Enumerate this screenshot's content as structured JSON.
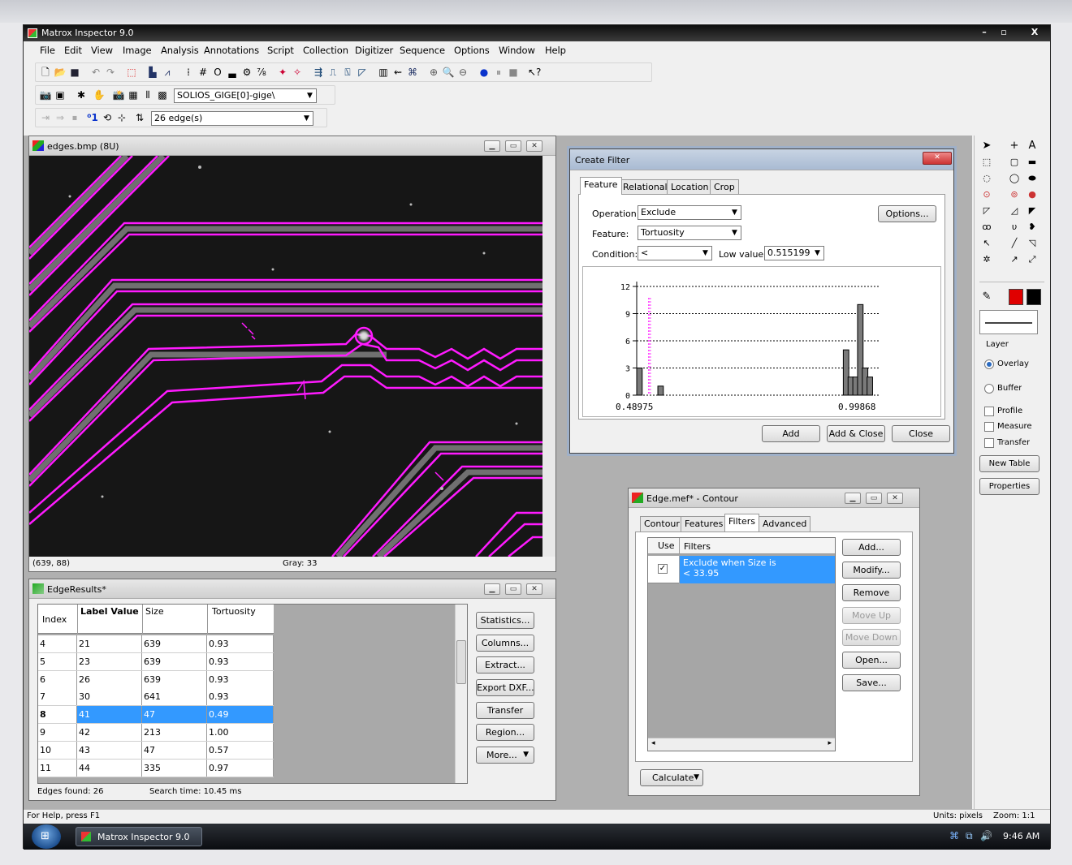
{
  "app": {
    "title": "Matrox Inspector 9.0"
  },
  "menu": [
    "File",
    "Edit",
    "View",
    "Image",
    "Analysis",
    "Annotations",
    "Script",
    "Collection",
    "Digitizer",
    "Sequence",
    "Options",
    "Window",
    "Help"
  ],
  "toolbar": {
    "camera_combo": "SOLIOS_GIGE[0]-gige\\",
    "edge_combo": "26 edge(s)"
  },
  "image_window": {
    "title": "edges.bmp (8U)",
    "coords": "(639, 88)",
    "gray": "Gray: 33"
  },
  "create_filter": {
    "title": "Create Filter",
    "tabs": [
      "Feature",
      "Relational",
      "Location",
      "Crop"
    ],
    "operation_label": "Operation:",
    "operation_value": "Exclude",
    "feature_label": "Feature:",
    "feature_value": "Tortuosity",
    "condition_label": "Condition:",
    "condition_value": "<",
    "low_value_label": "Low value:",
    "low_value": "0.515199",
    "options_button": "Options...",
    "add_button": "Add",
    "add_close_button": "Add & Close",
    "close_button": "Close"
  },
  "chart_data": {
    "type": "bar",
    "title": "",
    "xlabel": "",
    "ylabel": "",
    "xlim": [
      0.48975,
      0.99868
    ],
    "ylim": [
      0,
      12
    ],
    "x_tick_labels": [
      "0.48975",
      "0.99868"
    ],
    "y_tick_labels": [
      "0",
      "3",
      "6",
      "9",
      "12"
    ],
    "grid": true,
    "threshold": 0.515199,
    "bars": [
      {
        "x": 0.49,
        "y": 3
      },
      {
        "x": 0.54,
        "y": 1
      },
      {
        "x": 0.93,
        "y": 5
      },
      {
        "x": 0.94,
        "y": 2
      },
      {
        "x": 0.95,
        "y": 2
      },
      {
        "x": 0.96,
        "y": 10
      },
      {
        "x": 0.97,
        "y": 3
      },
      {
        "x": 0.98,
        "y": 2
      }
    ]
  },
  "edge_results": {
    "title": "EdgeResults*",
    "columns": [
      "Index",
      "Label Value",
      "Size",
      "Tortuosity"
    ],
    "rows": [
      [
        "4",
        "21",
        "639",
        "0.93"
      ],
      [
        "5",
        "23",
        "639",
        "0.93"
      ],
      [
        "6",
        "26",
        "639",
        "0.93"
      ],
      [
        "7",
        "30",
        "641",
        "0.93"
      ],
      [
        "8",
        "41",
        "47",
        "0.49"
      ],
      [
        "9",
        "42",
        "213",
        "1.00"
      ],
      [
        "10",
        "43",
        "47",
        "0.57"
      ],
      [
        "11",
        "44",
        "335",
        "0.97"
      ]
    ],
    "selected_row": 4,
    "buttons": [
      "Statistics...",
      "Columns...",
      "Extract...",
      "Export DXF...",
      "Transfer",
      "Region...",
      "More..."
    ],
    "edges_found": "Edges found: 26",
    "search_time": "Search time: 10.45 ms"
  },
  "contour": {
    "title": "Edge.mef* - Contour",
    "tabs": [
      "Contour",
      "Features",
      "Filters",
      "Advanced"
    ],
    "col_use": "Use",
    "col_filters": "Filters",
    "filter_line1": "Exclude when Size is",
    "filter_line2": "< 33.95",
    "buttons": [
      "Add...",
      "Modify...",
      "Remove",
      "Move Up",
      "Move Down",
      "Open...",
      "Save..."
    ],
    "calculate": "Calculate"
  },
  "palette": {
    "layer_label": "Layer",
    "overlay": "Overlay",
    "buffer": "Buffer",
    "profile": "Profile",
    "measure": "Measure",
    "transfer": "Transfer",
    "new_table": "New Table",
    "properties": "Properties",
    "colors": {
      "fg": "#e00000",
      "bg": "#000000"
    }
  },
  "status": {
    "help": "For Help, press F1",
    "units": "Units: pixels",
    "zoom": "Zoom: 1:1"
  },
  "taskbar": {
    "task": "Matrox Inspector 9.0",
    "time": "9:46 AM"
  }
}
